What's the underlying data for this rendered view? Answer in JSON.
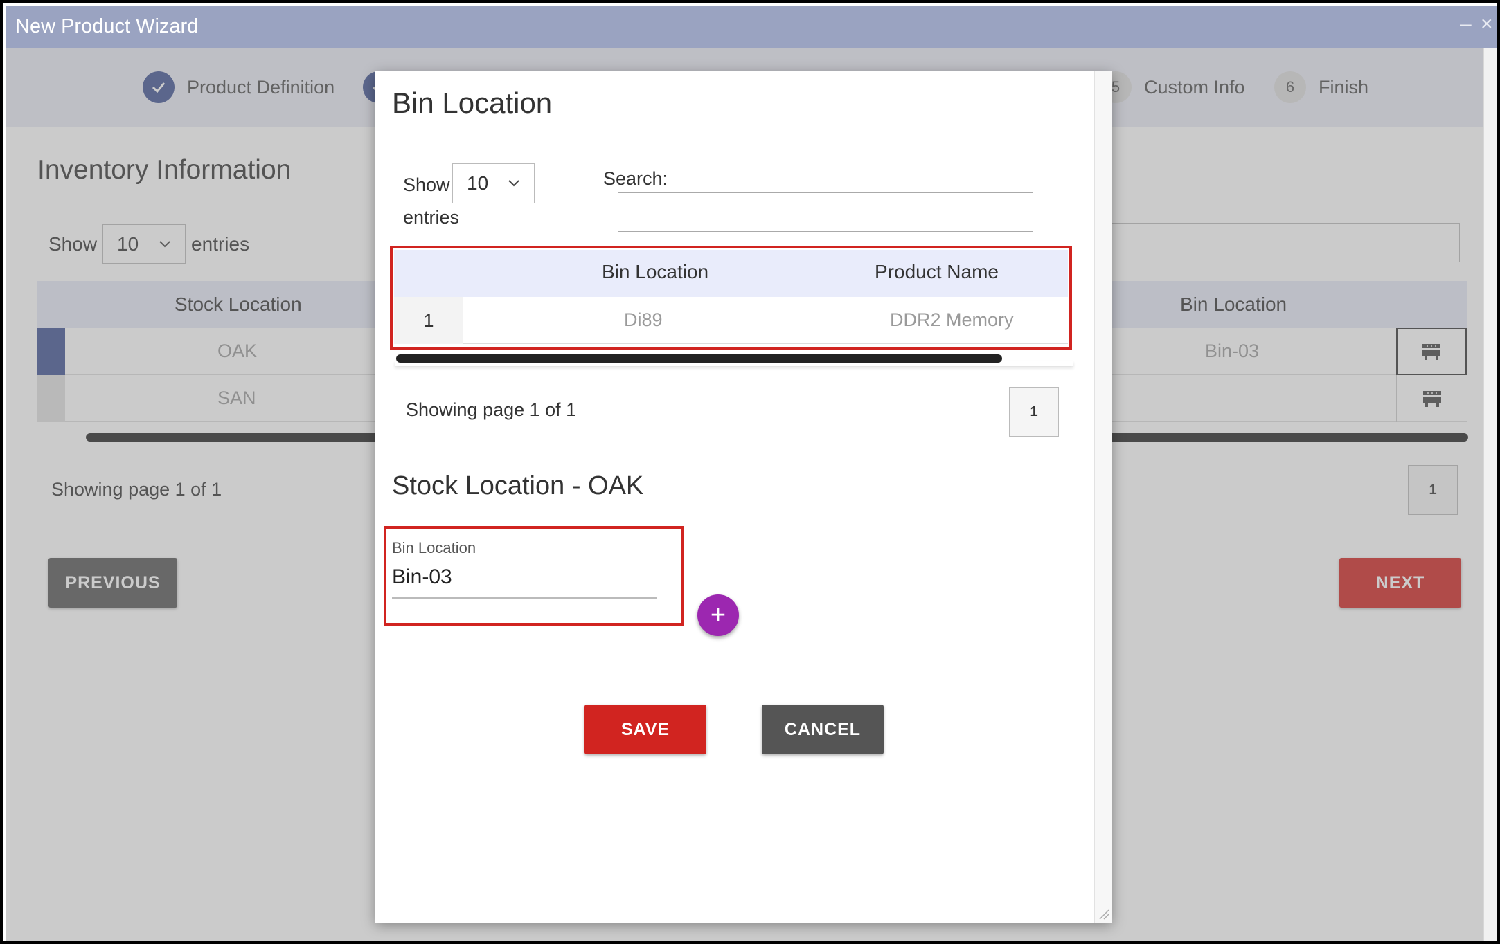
{
  "window": {
    "title": "New Product Wizard",
    "minimize_glyph": "‒",
    "close_glyph": "×"
  },
  "stepper": {
    "steps": [
      {
        "number": "",
        "label": "Product Definition",
        "state": "done"
      },
      {
        "number": "",
        "label": "",
        "state": "done"
      },
      {
        "number": "5",
        "label": "Custom Info",
        "state": "pending"
      },
      {
        "number": "6",
        "label": "Finish",
        "state": "pending"
      }
    ],
    "done_icon": "check-icon"
  },
  "inventory": {
    "title": "Inventory Information",
    "show_label": "Show",
    "entries_label": "entries",
    "page_size": "10",
    "columns": {
      "stock_location": "Stock Location",
      "bin_location": "Bin Location"
    },
    "rows": [
      {
        "stock_location": "OAK",
        "bin_location": "Bin-03"
      },
      {
        "stock_location": "SAN",
        "bin_location": ""
      }
    ],
    "row_action_icon": "bin-storage-icon",
    "showing_text": "Showing page 1 of 1",
    "pager_current": "1",
    "previous_label": "PREVIOUS",
    "next_label": "NEXT"
  },
  "modal": {
    "title": "Bin Location",
    "show_label": "Show",
    "entries_label": "entries",
    "page_size": "10",
    "search_label": "Search:",
    "search_value": "",
    "table": {
      "columns": [
        "Bin Location",
        "Product Name"
      ],
      "rows": [
        {
          "index": "1",
          "bin_location": "Di89",
          "product_name": "DDR2 Memory"
        }
      ]
    },
    "showing_text": "Showing page 1 of 1",
    "pager_current": "1",
    "subtitle": "Stock Location - OAK",
    "field_label": "Bin Location",
    "field_value": "Bin-03",
    "add_glyph": "+",
    "save_label": "SAVE",
    "cancel_label": "CANCEL"
  },
  "colors": {
    "titlebar": "#9aa3c1",
    "accent_blue": "#3f5193",
    "primary_red": "#d12420",
    "fab_purple": "#9c27b0",
    "highlight_box": "#d12420"
  }
}
